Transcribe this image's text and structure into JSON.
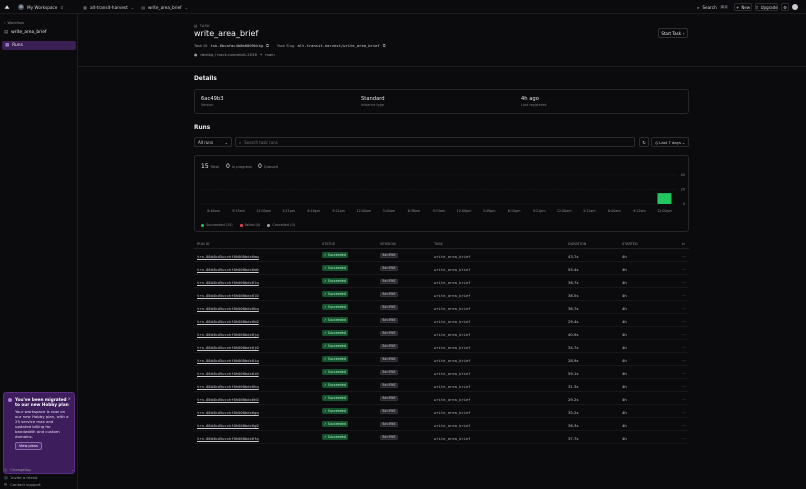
{
  "topbar": {
    "workspace_initial": "M",
    "workspace": "My Workspace",
    "project": "alt-transit-harvest",
    "task": "write_area_brief",
    "search": "Search",
    "search_kbd": "⌘ K",
    "new": "New",
    "upgrade": "Upgrade"
  },
  "sidebar": {
    "back": "Workflow",
    "task": "write_area_brief",
    "runs": "Runs",
    "promo": {
      "title": "You've been migrated to our new Hobby plan",
      "body": "Your workspace is now on our new Hobby plan, with a 25 service max and updated billing for bandwidth and custom domains.",
      "button": "View plans"
    },
    "changelog": "Changelog",
    "invite": "Invite a friend",
    "support": "Contact support"
  },
  "header": {
    "crumb": "TASK",
    "title": "write_area_brief",
    "start_button": "Start Task",
    "task_id_label": "Task ID",
    "task_id": "tsk-6bcafac4b0m0009hkkg",
    "task_slug_label": "Task Slug",
    "task_slug": "alt-transit-harvest/write_area_brief",
    "repo": "devtkg / track-nondeivit-2026",
    "branch": "main"
  },
  "details": {
    "heading": "Details",
    "cells": [
      {
        "value": "6ac49b3",
        "label": "Version"
      },
      {
        "value": "Standard",
        "label": "Instance type"
      },
      {
        "value": "4h ago",
        "label": "Last registered"
      }
    ]
  },
  "runs": {
    "heading": "Runs",
    "filter": "All runs",
    "search_placeholder": "Search task runs",
    "range": "Last 7 days",
    "stats": [
      {
        "value": "15",
        "label": "Total"
      },
      {
        "value": "0",
        "label": "In progress"
      },
      {
        "value": "0",
        "label": "Queued"
      }
    ],
    "legend": [
      {
        "label": "Succeeded (15)",
        "color": "#22c55e"
      },
      {
        "label": "Failed (0)",
        "color": "#ef4444"
      },
      {
        "label": "Cancelled (0)",
        "color": "#9ca3af"
      }
    ]
  },
  "chart_data": {
    "type": "bar",
    "categories": [
      "8:46am",
      "9:15am",
      "12:00pm",
      "3:21pm",
      "6:16pm",
      "9:21pm",
      "12:00am",
      "3:45am",
      "6:38am",
      "9:15am",
      "12:00pm",
      "3:49pm",
      "6:15pm",
      "9:21pm",
      "12:00am",
      "3:11am",
      "6:00am",
      "9:12am",
      "12:00pm"
    ],
    "series": [
      {
        "name": "Succeeded",
        "values": [
          0,
          0,
          0,
          0,
          0,
          0,
          0,
          0,
          0,
          0,
          0,
          0,
          0,
          0,
          0,
          0,
          0,
          0,
          15
        ]
      },
      {
        "name": "Failed",
        "values": [
          0,
          0,
          0,
          0,
          0,
          0,
          0,
          0,
          0,
          0,
          0,
          0,
          0,
          0,
          0,
          0,
          0,
          0,
          0
        ]
      },
      {
        "name": "Cancelled",
        "values": [
          0,
          0,
          0,
          0,
          0,
          0,
          0,
          0,
          0,
          0,
          0,
          0,
          0,
          0,
          0,
          0,
          0,
          0,
          0
        ]
      }
    ],
    "yticks": [
      "40",
      "20",
      "0"
    ],
    "ylim": [
      0,
      40
    ],
    "colors": {
      "Succeeded": "#22c55e"
    }
  },
  "table": {
    "headers": [
      "RUN ID",
      "STATUS",
      "VERSION",
      "TASK",
      "DURATION",
      "STARTED"
    ],
    "rows": [
      {
        "id": "trn-08d4kd5ucchf0h000bdc6mq",
        "status": "Succeeded",
        "version": "6ac49b3",
        "task": "write_area_brief",
        "duration": "43.7s",
        "started": "4h"
      },
      {
        "id": "trn-08d4kd5ucchf0h000bdc6m0",
        "status": "Succeeded",
        "version": "6ac49b3",
        "task": "write_area_brief",
        "duration": "55.4s",
        "started": "4h"
      },
      {
        "id": "trn-08d4kd5ucchf0h000bdc6lq",
        "status": "Succeeded",
        "version": "6ac49b3",
        "task": "write_area_brief",
        "duration": "36.7s",
        "started": "4h"
      },
      {
        "id": "trn-08d4kd5ucchf0h000bdc6l0",
        "status": "Succeeded",
        "version": "6ac49b3",
        "task": "write_area_brief",
        "duration": "38.5s",
        "started": "4h"
      },
      {
        "id": "trn-08d4kd5ucchf0h000bdc6kq",
        "status": "Succeeded",
        "version": "6ac49b3",
        "task": "write_area_brief",
        "duration": "36.7s",
        "started": "4h"
      },
      {
        "id": "trn-08d4kd5ucchf0h000bdc6k0",
        "status": "Succeeded",
        "version": "6ac49b3",
        "task": "write_area_brief",
        "duration": "29.4s",
        "started": "4h"
      },
      {
        "id": "trn-08d4kd5ucchf0h000bdc6jq",
        "status": "Succeeded",
        "version": "6ac49b3",
        "task": "write_area_brief",
        "duration": "40.9s",
        "started": "4h"
      },
      {
        "id": "trn-08d4kd5ucchf0h000bdc6j0",
        "status": "Succeeded",
        "version": "6ac49b3",
        "task": "write_area_brief",
        "duration": "34.7s",
        "started": "4h"
      },
      {
        "id": "trn-08d4kd5ucchf0h000bdc6iq",
        "status": "Succeeded",
        "version": "6ac49b3",
        "task": "write_area_brief",
        "duration": "28.9s",
        "started": "4h"
      },
      {
        "id": "trn-08d4kd5ucchf0h000bdc6i0",
        "status": "Succeeded",
        "version": "6ac49b3",
        "task": "write_area_brief",
        "duration": "59.1s",
        "started": "4h"
      },
      {
        "id": "trn-08d4kd5ucchf0h000bdc6hq",
        "status": "Succeeded",
        "version": "6ac49b3",
        "task": "write_area_brief",
        "duration": "31.3s",
        "started": "4h"
      },
      {
        "id": "trn-08d4kd5ucchf0h000bdc6h0",
        "status": "Succeeded",
        "version": "6ac49b3",
        "task": "write_area_brief",
        "duration": "29.2s",
        "started": "4h"
      },
      {
        "id": "trn-08d4kd5ucchf0h000bdc6gq",
        "status": "Succeeded",
        "version": "6ac49b3",
        "task": "write_area_brief",
        "duration": "35.2s",
        "started": "4h"
      },
      {
        "id": "trn-08d4kd5ucchf0h000bdc6g0",
        "status": "Succeeded",
        "version": "6ac49b3",
        "task": "write_area_brief",
        "duration": "36.3s",
        "started": "4h"
      },
      {
        "id": "trn-08d4kd5ucchf0h000bdc6fq",
        "status": "Succeeded",
        "version": "6ac49b3",
        "task": "write_area_brief",
        "duration": "37.7s",
        "started": "4h"
      }
    ]
  }
}
